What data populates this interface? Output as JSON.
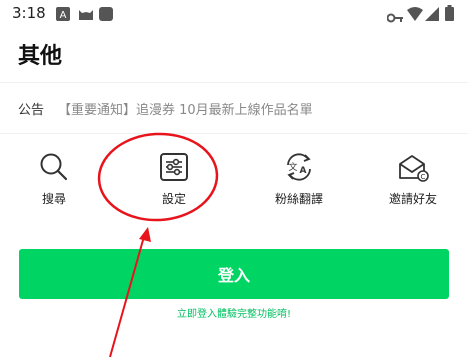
{
  "status_bar": {
    "time": "3:18",
    "left_icons": [
      "font-a-icon",
      "cat-icon",
      "square-app-icon"
    ],
    "right_icons": [
      "key-icon",
      "wifi-icon",
      "signal-icon",
      "battery-icon"
    ]
  },
  "page": {
    "title": "其他"
  },
  "announcement": {
    "label": "公告",
    "text": "【重要通知】追漫券 10月最新上線作品名單"
  },
  "menu": [
    {
      "label": "搜尋",
      "icon": "search-icon"
    },
    {
      "label": "設定",
      "icon": "settings-sliders-icon"
    },
    {
      "label": "粉絲翻譯",
      "icon": "translate-icon"
    },
    {
      "label": "邀請好友",
      "icon": "invite-mail-icon"
    }
  ],
  "login": {
    "button_label": "登入",
    "hint": "立即登入體驗完整功能唷!"
  },
  "colors": {
    "accent": "#00d564",
    "annotation": "#e8141c"
  }
}
